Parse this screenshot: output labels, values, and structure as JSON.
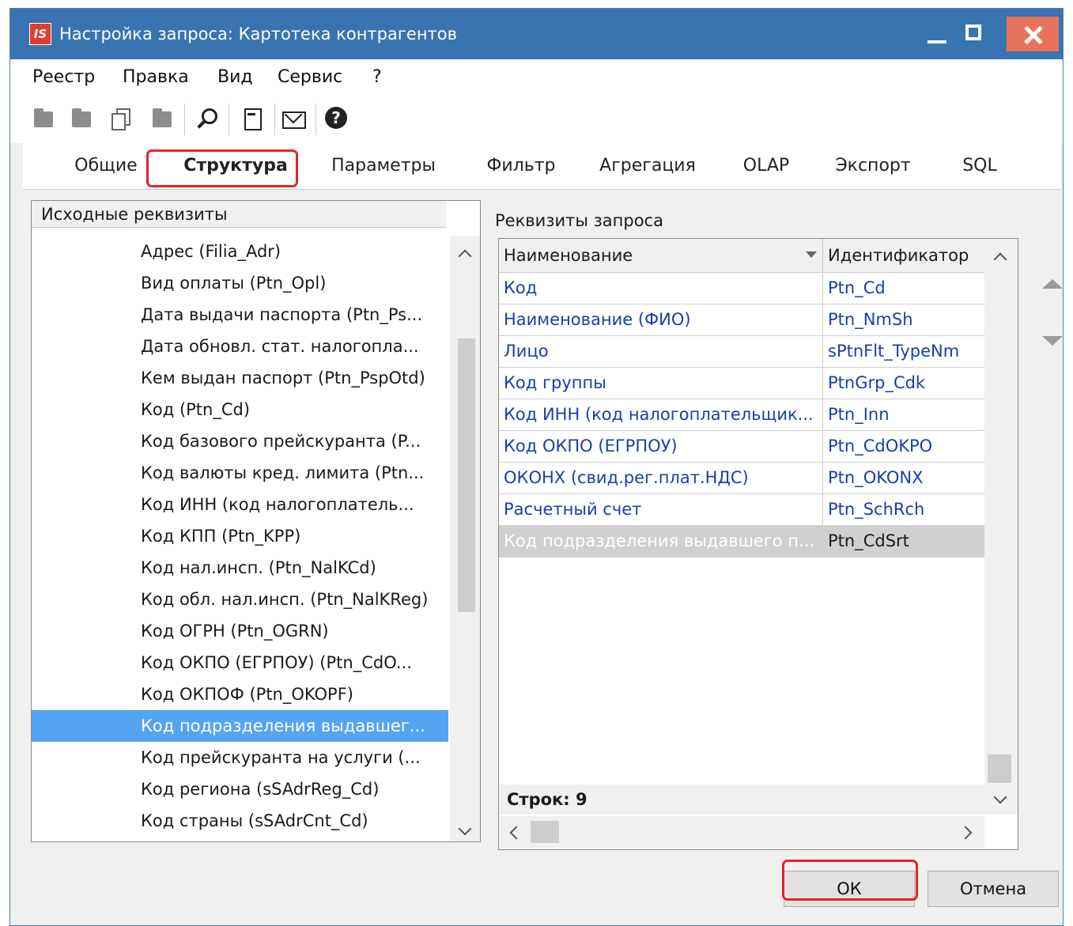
{
  "window": {
    "title": "Настройка запроса: Картотека контрагентов",
    "app_logo": "IS"
  },
  "menu": [
    "Реестр",
    "Правка",
    "Вид",
    "Сервис",
    "?"
  ],
  "toolbar_icons": [
    "folder-icon",
    "folder-icon",
    "copy-icon",
    "folder-icon",
    "search-icon",
    "form-icon",
    "mail-icon",
    "help-icon"
  ],
  "tabs": [
    {
      "label": "Общие"
    },
    {
      "label": "Структура",
      "active": true
    },
    {
      "label": "Параметры"
    },
    {
      "label": "Фильтр"
    },
    {
      "label": "Агрегация"
    },
    {
      "label": "OLAP"
    },
    {
      "label": "Экспорт"
    },
    {
      "label": "SQL"
    }
  ],
  "source_panel": {
    "header": "Исходные реквизиты",
    "items": [
      "Адрес (Filia_Adr)",
      "Вид оплаты (Ptn_Opl)",
      "Дата выдачи паспорта (Ptn_Ps...",
      "Дата обновл. стат. налогопла...",
      "Кем выдан паспорт (Ptn_PspOtd)",
      "Код (Ptn_Cd)",
      "Код базового прейскуранта (P...",
      "Код валюты кред. лимита (Ptn...",
      "Код ИНН (код налогоплатель...",
      "Код КПП (Ptn_KPP)",
      "Код нал.инсп. (Ptn_NalKCd)",
      "Код обл. нал.инсп. (Ptn_NalKReg)",
      "Код ОГРН (Ptn_OGRN)",
      "Код ОКПО (ЕГРПОУ) (Ptn_CdO...",
      "Код ОКПОФ (Ptn_OKOPF)",
      "Код подразделения выдавшег...",
      "Код прейскуранта на услуги (...",
      "Код региона (sSAdrReg_Cd)",
      "Код страны (sSAdrCnt_Cd)"
    ],
    "selected_index": 15
  },
  "query_panel": {
    "title": "Реквизиты запроса",
    "columns": {
      "name": "Наименование",
      "id": "Идентификатор"
    },
    "rows": [
      {
        "name": "Код",
        "id": "Ptn_Cd"
      },
      {
        "name": "Наименование (ФИО)",
        "id": "Ptn_NmSh"
      },
      {
        "name": "Лицо",
        "id": "sPtnFlt_TypeNm"
      },
      {
        "name": "Код группы",
        "id": "PtnGrp_Cdk"
      },
      {
        "name": "Код ИНН (код налогоплательщик...",
        "id": "Ptn_Inn"
      },
      {
        "name": "Код ОКПО (ЕГРПОУ)",
        "id": "Ptn_CdOKPO"
      },
      {
        "name": "ОКОНХ (свид.рег.плат.НДС)",
        "id": "Ptn_OKONX"
      },
      {
        "name": "Расчетный счет",
        "id": "Ptn_SchRch"
      },
      {
        "name": "Код подразделения выдавшего п...",
        "id": "Ptn_CdSrt"
      }
    ],
    "selected_index": 8,
    "footer": "Строк: 9"
  },
  "buttons": {
    "ok": "ОК",
    "cancel": "Отмена"
  },
  "colors": {
    "titlebar": "#3a73b2",
    "selection": "#54a4f2",
    "highlight": "#e0262c",
    "link_text": "#1a3ea8"
  }
}
